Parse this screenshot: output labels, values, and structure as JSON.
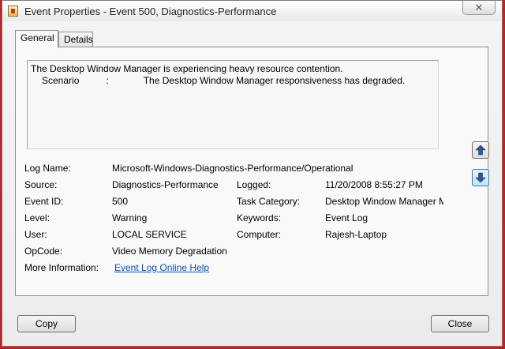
{
  "window": {
    "title": "Event Properties - Event 500, Diagnostics-Performance",
    "close_glyph": "✕"
  },
  "tabs": [
    {
      "label": "General",
      "active": true
    },
    {
      "label": "Details",
      "active": false
    }
  ],
  "description": {
    "line1": "The Desktop Window Manager is experiencing heavy resource contention.",
    "line2_label": "Scenario",
    "line2_sep": ":",
    "line2_value": "The Desktop Window Manager responsiveness has degraded."
  },
  "fields": {
    "log_name": {
      "label": "Log Name:",
      "value": "Microsoft-Windows-Diagnostics-Performance/Operational"
    },
    "source": {
      "label": "Source:",
      "value": "Diagnostics-Performance"
    },
    "logged": {
      "label": "Logged:",
      "value": "11/20/2008 8:55:27 PM"
    },
    "event_id": {
      "label": "Event ID:",
      "value": "500"
    },
    "task_category": {
      "label": "Task Category:",
      "value": "Desktop Window Manager M"
    },
    "level": {
      "label": "Level:",
      "value": "Warning"
    },
    "keywords": {
      "label": "Keywords:",
      "value": "Event Log"
    },
    "user": {
      "label": "User:",
      "value": "LOCAL SERVICE"
    },
    "computer": {
      "label": "Computer:",
      "value": "Rajesh-Laptop"
    },
    "opcode": {
      "label": "OpCode:",
      "value": "Video Memory Degradation"
    },
    "more_info": {
      "label": "More Information:",
      "value": "Event Log Online Help"
    }
  },
  "nav": {
    "up_icon": "arrow-up-icon",
    "down_icon": "arrow-down-icon"
  },
  "buttons": {
    "copy": "Copy",
    "close": "Close"
  }
}
